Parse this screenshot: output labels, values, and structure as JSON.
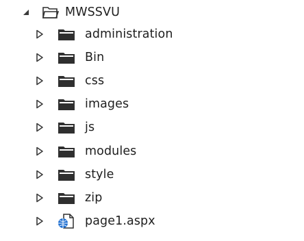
{
  "tree": {
    "root": {
      "label": "MWSSVU",
      "state": "expanded",
      "icon": "folder-open-icon"
    },
    "items": [
      {
        "label": "administration",
        "type": "folder",
        "icon": "folder-icon",
        "state": "collapsed"
      },
      {
        "label": "Bin",
        "type": "folder",
        "icon": "folder-icon",
        "state": "collapsed"
      },
      {
        "label": "css",
        "type": "folder",
        "icon": "folder-icon",
        "state": "collapsed"
      },
      {
        "label": "images",
        "type": "folder",
        "icon": "folder-icon",
        "state": "collapsed"
      },
      {
        "label": "js",
        "type": "folder",
        "icon": "folder-icon",
        "state": "collapsed"
      },
      {
        "label": "modules",
        "type": "folder",
        "icon": "folder-icon",
        "state": "collapsed"
      },
      {
        "label": "style",
        "type": "folder",
        "icon": "folder-icon",
        "state": "collapsed"
      },
      {
        "label": "zip",
        "type": "folder",
        "icon": "folder-icon",
        "state": "collapsed"
      },
      {
        "label": "page1.aspx",
        "type": "aspx-file",
        "icon": "aspx-file-icon",
        "state": "collapsed"
      }
    ]
  },
  "colors": {
    "text": "#1e1e1e",
    "folder": "#2f2f2f",
    "arrow": "#3a3a3a",
    "globe": "#1f6fd1",
    "background": "#ffffff"
  }
}
